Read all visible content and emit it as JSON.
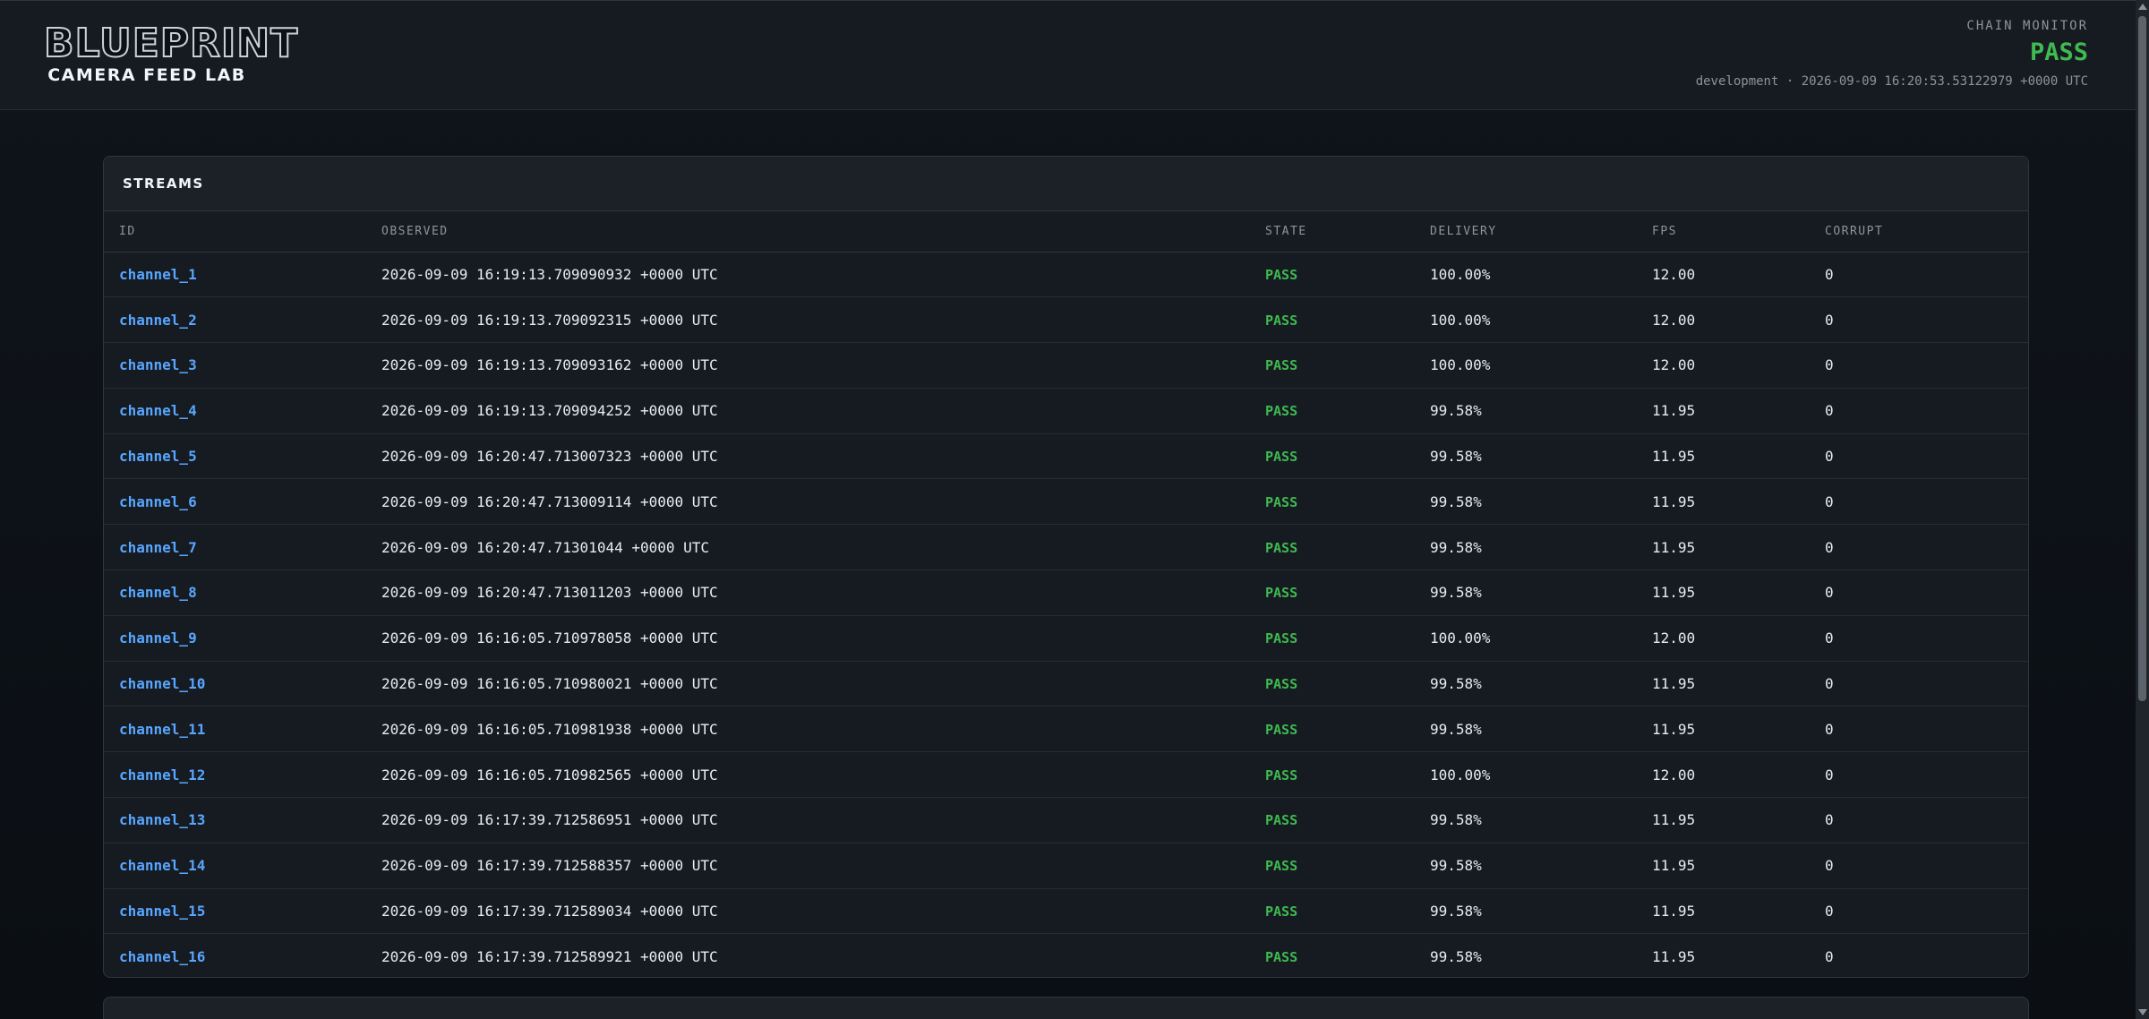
{
  "header": {
    "logo_word": "BLUEPRINT",
    "logo_sub": "CAMERA FEED LAB",
    "monitor_label": "CHAIN MONITOR",
    "monitor_status": "PASS",
    "monitor_meta": "development · 2026-09-09 16:20:53.53122979 +0000 UTC"
  },
  "streams": {
    "title": "STREAMS",
    "columns": [
      "ID",
      "OBSERVED",
      "STATE",
      "DELIVERY",
      "FPS",
      "CORRUPT"
    ],
    "rows": [
      {
        "id": "channel_1",
        "observed": "2026-09-09 16:19:13.709090932 +0000 UTC",
        "state": "PASS",
        "delivery": "100.00%",
        "fps": "12.00",
        "corrupt": "0"
      },
      {
        "id": "channel_2",
        "observed": "2026-09-09 16:19:13.709092315 +0000 UTC",
        "state": "PASS",
        "delivery": "100.00%",
        "fps": "12.00",
        "corrupt": "0"
      },
      {
        "id": "channel_3",
        "observed": "2026-09-09 16:19:13.709093162 +0000 UTC",
        "state": "PASS",
        "delivery": "100.00%",
        "fps": "12.00",
        "corrupt": "0"
      },
      {
        "id": "channel_4",
        "observed": "2026-09-09 16:19:13.709094252 +0000 UTC",
        "state": "PASS",
        "delivery": "99.58%",
        "fps": "11.95",
        "corrupt": "0"
      },
      {
        "id": "channel_5",
        "observed": "2026-09-09 16:20:47.713007323 +0000 UTC",
        "state": "PASS",
        "delivery": "99.58%",
        "fps": "11.95",
        "corrupt": "0"
      },
      {
        "id": "channel_6",
        "observed": "2026-09-09 16:20:47.713009114 +0000 UTC",
        "state": "PASS",
        "delivery": "99.58%",
        "fps": "11.95",
        "corrupt": "0"
      },
      {
        "id": "channel_7",
        "observed": "2026-09-09 16:20:47.71301044 +0000 UTC",
        "state": "PASS",
        "delivery": "99.58%",
        "fps": "11.95",
        "corrupt": "0"
      },
      {
        "id": "channel_8",
        "observed": "2026-09-09 16:20:47.713011203 +0000 UTC",
        "state": "PASS",
        "delivery": "99.58%",
        "fps": "11.95",
        "corrupt": "0"
      },
      {
        "id": "channel_9",
        "observed": "2026-09-09 16:16:05.710978058 +0000 UTC",
        "state": "PASS",
        "delivery": "100.00%",
        "fps": "12.00",
        "corrupt": "0"
      },
      {
        "id": "channel_10",
        "observed": "2026-09-09 16:16:05.710980021 +0000 UTC",
        "state": "PASS",
        "delivery": "99.58%",
        "fps": "11.95",
        "corrupt": "0"
      },
      {
        "id": "channel_11",
        "observed": "2026-09-09 16:16:05.710981938 +0000 UTC",
        "state": "PASS",
        "delivery": "99.58%",
        "fps": "11.95",
        "corrupt": "0"
      },
      {
        "id": "channel_12",
        "observed": "2026-09-09 16:16:05.710982565 +0000 UTC",
        "state": "PASS",
        "delivery": "100.00%",
        "fps": "12.00",
        "corrupt": "0"
      },
      {
        "id": "channel_13",
        "observed": "2026-09-09 16:17:39.712586951 +0000 UTC",
        "state": "PASS",
        "delivery": "99.58%",
        "fps": "11.95",
        "corrupt": "0"
      },
      {
        "id": "channel_14",
        "observed": "2026-09-09 16:17:39.712588357 +0000 UTC",
        "state": "PASS",
        "delivery": "99.58%",
        "fps": "11.95",
        "corrupt": "0"
      },
      {
        "id": "channel_15",
        "observed": "2026-09-09 16:17:39.712589034 +0000 UTC",
        "state": "PASS",
        "delivery": "99.58%",
        "fps": "11.95",
        "corrupt": "0"
      },
      {
        "id": "channel_16",
        "observed": "2026-09-09 16:17:39.712589921 +0000 UTC",
        "state": "PASS",
        "delivery": "99.58%",
        "fps": "11.95",
        "corrupt": "0"
      }
    ]
  },
  "colors": {
    "background": "#0d1117",
    "panel": "#161b22",
    "link": "#58a6ff",
    "pass": "#3fb950",
    "muted": "#8b949e"
  }
}
